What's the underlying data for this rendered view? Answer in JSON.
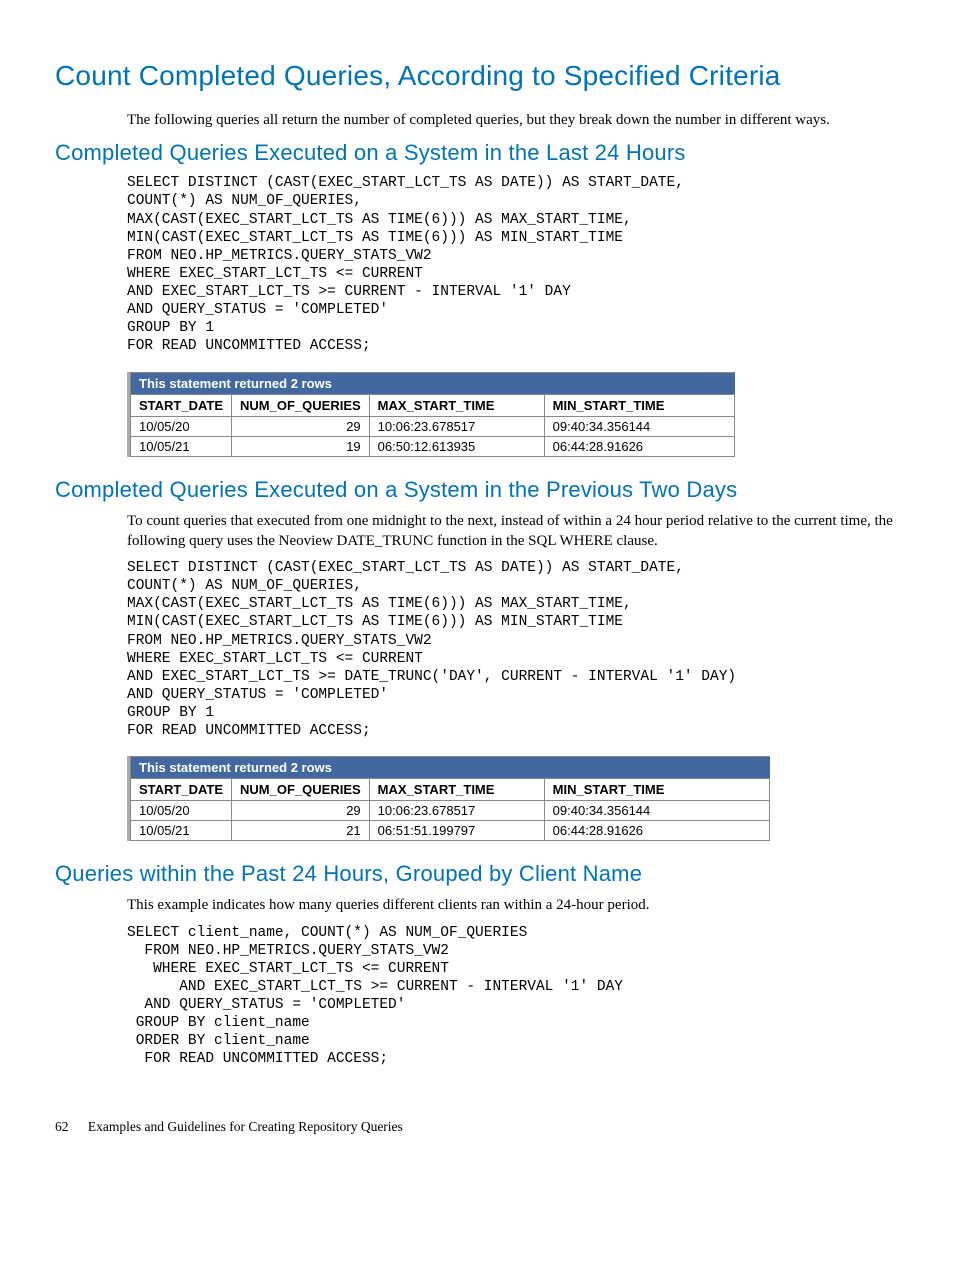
{
  "h1": "Count Completed Queries, According to Specified Criteria",
  "intro": "The following queries all return the number of completed queries, but they break down the number in different ways.",
  "section1": {
    "heading": "Completed Queries Executed on a System in the Last 24 Hours",
    "code": "SELECT DISTINCT (CAST(EXEC_START_LCT_TS AS DATE)) AS START_DATE,\nCOUNT(*) AS NUM_OF_QUERIES,\nMAX(CAST(EXEC_START_LCT_TS AS TIME(6))) AS MAX_START_TIME,\nMIN(CAST(EXEC_START_LCT_TS AS TIME(6))) AS MIN_START_TIME\nFROM NEO.HP_METRICS.QUERY_STATS_VW2\nWHERE EXEC_START_LCT_TS <= CURRENT\nAND EXEC_START_LCT_TS >= CURRENT - INTERVAL '1' DAY\nAND QUERY_STATUS = 'COMPLETED'\nGROUP BY 1\nFOR READ UNCOMMITTED ACCESS;",
    "result_caption": "This statement returned 2 rows",
    "cols": {
      "c0": "START_DATE",
      "c1": "NUM_OF_QUERIES",
      "c2": "MAX_START_TIME",
      "c3": "MIN_START_TIME"
    },
    "rows": {
      "r0": {
        "c0": "10/05/20",
        "c1": "29",
        "c2": "10:06:23.678517",
        "c3": "09:40:34.356144"
      },
      "r1": {
        "c0": "10/05/21",
        "c1": "19",
        "c2": "06:50:12.613935",
        "c3": "06:44:28.91626"
      }
    },
    "widths": {
      "c0": "95",
      "c1": "130",
      "c2": "175",
      "c3": "190"
    }
  },
  "section2": {
    "heading": "Completed Queries Executed on a System in the Previous Two Days",
    "intro": "To count queries that executed from one midnight to the next, instead of within a 24 hour period relative to the current time, the following query uses the Neoview DATE_TRUNC function in the SQL WHERE clause.",
    "code": "SELECT DISTINCT (CAST(EXEC_START_LCT_TS AS DATE)) AS START_DATE,\nCOUNT(*) AS NUM_OF_QUERIES,\nMAX(CAST(EXEC_START_LCT_TS AS TIME(6))) AS MAX_START_TIME,\nMIN(CAST(EXEC_START_LCT_TS AS TIME(6))) AS MIN_START_TIME\nFROM NEO.HP_METRICS.QUERY_STATS_VW2\nWHERE EXEC_START_LCT_TS <= CURRENT\nAND EXEC_START_LCT_TS >= DATE_TRUNC('DAY', CURRENT - INTERVAL '1' DAY)\nAND QUERY_STATUS = 'COMPLETED'\nGROUP BY 1\nFOR READ UNCOMMITTED ACCESS;",
    "result_caption": "This statement returned 2 rows",
    "cols": {
      "c0": "START_DATE",
      "c1": "NUM_OF_QUERIES",
      "c2": "MAX_START_TIME",
      "c3": "MIN_START_TIME"
    },
    "rows": {
      "r0": {
        "c0": "10/05/20",
        "c1": "29",
        "c2": "10:06:23.678517",
        "c3": "09:40:34.356144"
      },
      "r1": {
        "c0": "10/05/21",
        "c1": "21",
        "c2": "06:51:51.199797",
        "c3": "06:44:28.91626"
      }
    },
    "widths": {
      "c0": "95",
      "c1": "130",
      "c2": "175",
      "c3": "225"
    }
  },
  "section3": {
    "heading": "Queries within the Past 24 Hours, Grouped by Client Name",
    "intro": "This example indicates how many queries different clients ran within a 24-hour period.",
    "code": "SELECT client_name, COUNT(*) AS NUM_OF_QUERIES\n  FROM NEO.HP_METRICS.QUERY_STATS_VW2\n   WHERE EXEC_START_LCT_TS <= CURRENT\n      AND EXEC_START_LCT_TS >= CURRENT - INTERVAL '1' DAY\n  AND QUERY_STATUS = 'COMPLETED'\n GROUP BY client_name\n ORDER BY client_name\n  FOR READ UNCOMMITTED ACCESS;"
  },
  "footer": {
    "page": "62",
    "chapter": "Examples and Guidelines for Creating Repository Queries"
  }
}
